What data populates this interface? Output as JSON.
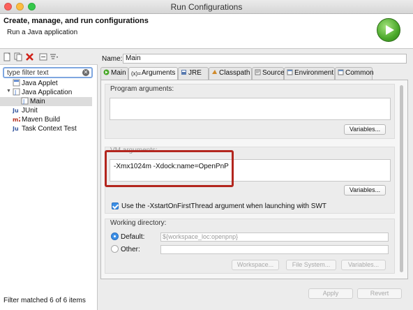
{
  "window": {
    "title": "Run Configurations"
  },
  "header": {
    "title": "Create, manage, and run configurations",
    "subtitle": "Run a Java application",
    "icon": "run-icon"
  },
  "left": {
    "filter_placeholder": "type filter text",
    "tree": [
      {
        "label": "Java Applet",
        "icon": "java-applet-icon"
      },
      {
        "label": "Java Application",
        "icon": "java-application-icon",
        "expanded": true
      },
      {
        "label": "Main",
        "icon": "java-main-icon",
        "selected": true
      },
      {
        "label": "JUnit",
        "icon": "junit-icon"
      },
      {
        "label": "Maven Build",
        "icon": "maven-icon"
      },
      {
        "label": "Task Context Test",
        "icon": "task-context-icon"
      }
    ],
    "status": "Filter matched 6 of 6 items"
  },
  "config": {
    "name_label": "Name:",
    "name_value": "Main",
    "tabs": [
      {
        "label": "Main",
        "icon": "main-tab-icon"
      },
      {
        "label": "Arguments",
        "icon": "arguments-tab-icon",
        "active": true
      },
      {
        "label": "JRE",
        "icon": "jre-tab-icon"
      },
      {
        "label": "Classpath",
        "icon": "classpath-tab-icon"
      },
      {
        "label": "Source",
        "icon": "source-tab-icon"
      },
      {
        "label": "Environment",
        "icon": "environment-tab-icon"
      },
      {
        "label": "Common",
        "icon": "common-tab-icon"
      }
    ],
    "program_args_label": "Program arguments:",
    "program_args_value": "",
    "vm_args_label": "VM arguments:",
    "vm_args_value": "-Xmx1024m -Xdock:name=OpenPnP",
    "variables_label": "Variables...",
    "checkbox_label": "Use the -XstartOnFirstThread argument when launching with SWT",
    "checkbox_checked": true,
    "working_dir_label": "Working directory:",
    "default_label": "Default:",
    "default_value": "${workspace_loc:openpnp}",
    "other_label": "Other:",
    "workspace_btn": "Workspace...",
    "filesystem_btn": "File System...",
    "apply_btn": "Apply",
    "revert_btn": "Revert"
  },
  "colors": {
    "highlight": "#b3261e",
    "accent": "#3b8fe6"
  }
}
